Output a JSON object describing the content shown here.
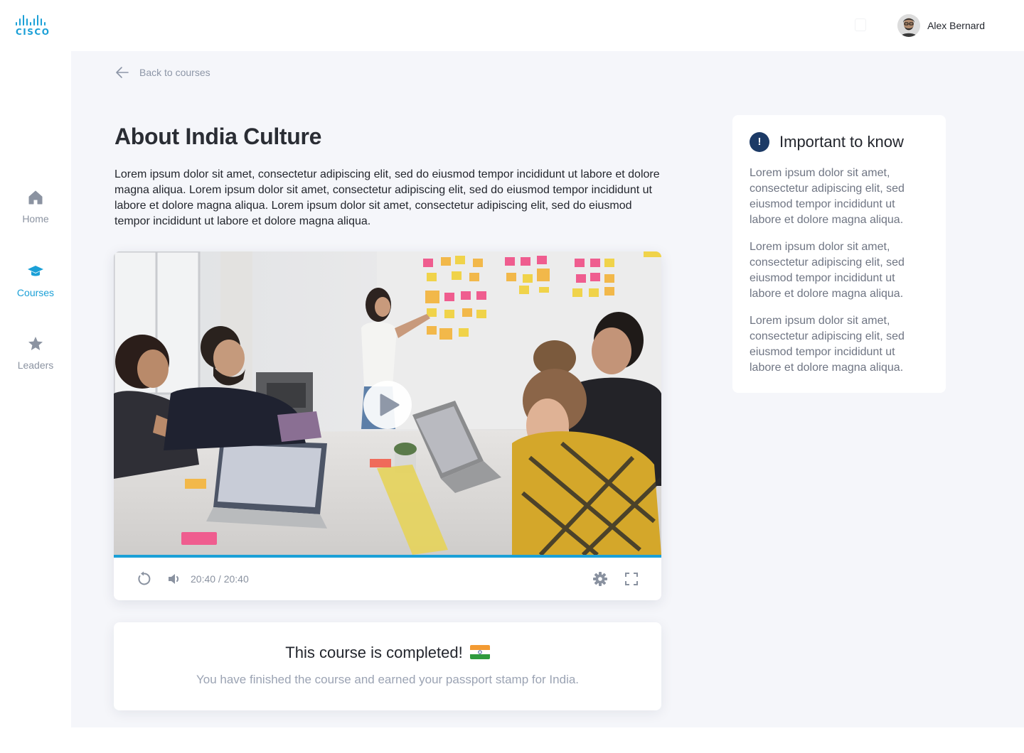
{
  "brand": {
    "logo_text": "CISCO",
    "accent_color": "#1ba0d7"
  },
  "sidebar": {
    "items": [
      {
        "label": "Home",
        "icon": "home-icon",
        "active": false
      },
      {
        "label": "Courses",
        "icon": "graduation-cap-icon",
        "active": true
      },
      {
        "label": "Leaders",
        "icon": "star-icon",
        "active": false
      }
    ]
  },
  "header": {
    "user_name": "Alex Bernard",
    "avatar_icon": "avatar"
  },
  "main": {
    "back_label": "Back to courses",
    "title": "About India Culture",
    "description": "Lorem ipsum dolor sit amet, consectetur adipiscing elit, sed do eiusmod tempor incididunt ut labore et dolore magna aliqua. Lorem ipsum dolor sit amet, consectetur adipiscing elit, sed do eiusmod tempor incididunt ut labore et dolore magna aliqua. Lorem ipsum dolor sit amet, consectetur adipiscing elit, sed do eiusmod tempor incididunt ut labore et dolore magna aliqua."
  },
  "video": {
    "time": "20:40 / 20:40",
    "progress": 1.0,
    "controls": [
      "replay-icon",
      "volume-icon",
      "settings-icon",
      "fullscreen-icon"
    ],
    "play_icon": "play-icon"
  },
  "completion": {
    "title": "This course is completed!",
    "flag_icon": "india-flag-icon",
    "subtitle": "You have finished the course and earned your passport stamp for India."
  },
  "info_panel": {
    "badge": "!",
    "title": "Important to know",
    "paragraphs": [
      "Lorem ipsum dolor sit amet, consectetur adipiscing elit, sed eiusmod tempor incididunt ut labore et dolore magna aliqua.",
      "Lorem ipsum dolor sit amet, consectetur adipiscing elit, sed eiusmod tempor incididunt ut labore et dolore magna aliqua.",
      "Lorem ipsum dolor sit amet, consectetur adipiscing elit, sed eiusmod tempor incididunt ut labore et dolore magna aliqua."
    ]
  }
}
